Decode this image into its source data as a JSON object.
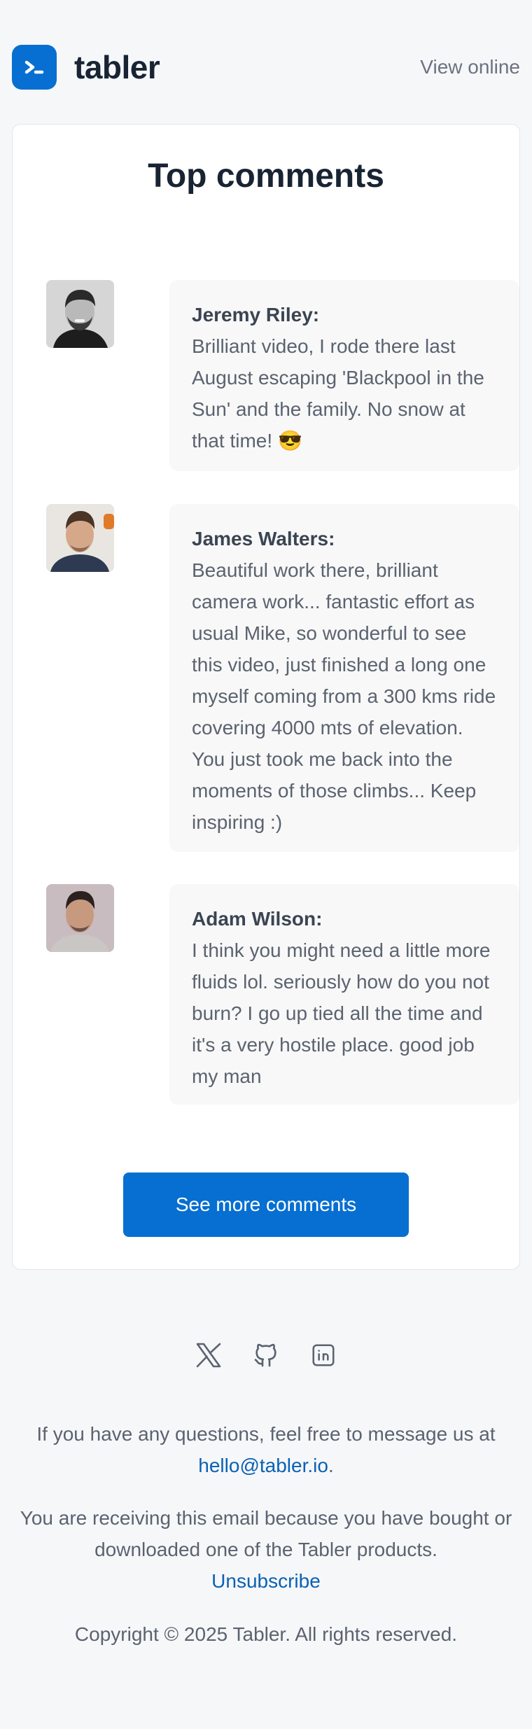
{
  "header": {
    "brand_name": "tabler",
    "view_online": "View online"
  },
  "card": {
    "title": "Top comments",
    "comments": [
      {
        "author": "Jeremy Riley:",
        "text": "Brilliant video, I rode there last August escaping 'Blackpool in the Sun' and the family. No snow at that time! 😎"
      },
      {
        "author": "James Walters:",
        "text": "Beautiful work there, brilliant camera work... fantastic effort as usual Mike, so wonderful to see this video, just finished a long one myself coming from a 300 kms ride covering 4000 mts of elevation. You just took me back into the moments of those climbs... Keep inspiring :)"
      },
      {
        "author": "Adam Wilson:",
        "text": "I think you might need a little more fluids lol. seriously how do you not burn? I go up tied all the time and it's a very hostile place. good job my man"
      }
    ],
    "cta_label": "See more comments"
  },
  "footer": {
    "social_icons": [
      "x-icon",
      "github-icon",
      "linkedin-icon"
    ],
    "questions_text": "If you have any questions, feel free to message us at",
    "email": "hello@tabler.io",
    "email_suffix": ".",
    "receiving_text": "You are receiving this email because you have bought or downloaded one of the Tabler products.",
    "unsubscribe": "Unsubscribe",
    "copyright": "Copyright © 2025 Tabler. All rights reserved."
  },
  "colors": {
    "brand": "#066fd1",
    "background": "#f6f7f9",
    "link": "#0a61b4"
  }
}
